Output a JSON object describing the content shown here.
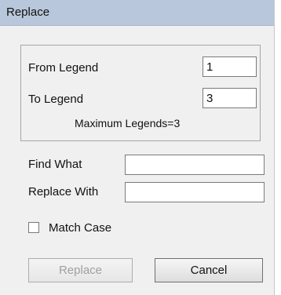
{
  "window": {
    "title": "Replace"
  },
  "legend_range": {
    "from_label": "From Legend",
    "from_value": "1",
    "to_label": "To Legend",
    "to_value": "3",
    "max_text": "Maximum Legends=3"
  },
  "find": {
    "label": "Find What",
    "value": ""
  },
  "replace": {
    "label": "Replace With",
    "value": ""
  },
  "match_case": {
    "label": "Match Case",
    "checked": false
  },
  "buttons": {
    "replace": "Replace",
    "cancel": "Cancel"
  }
}
